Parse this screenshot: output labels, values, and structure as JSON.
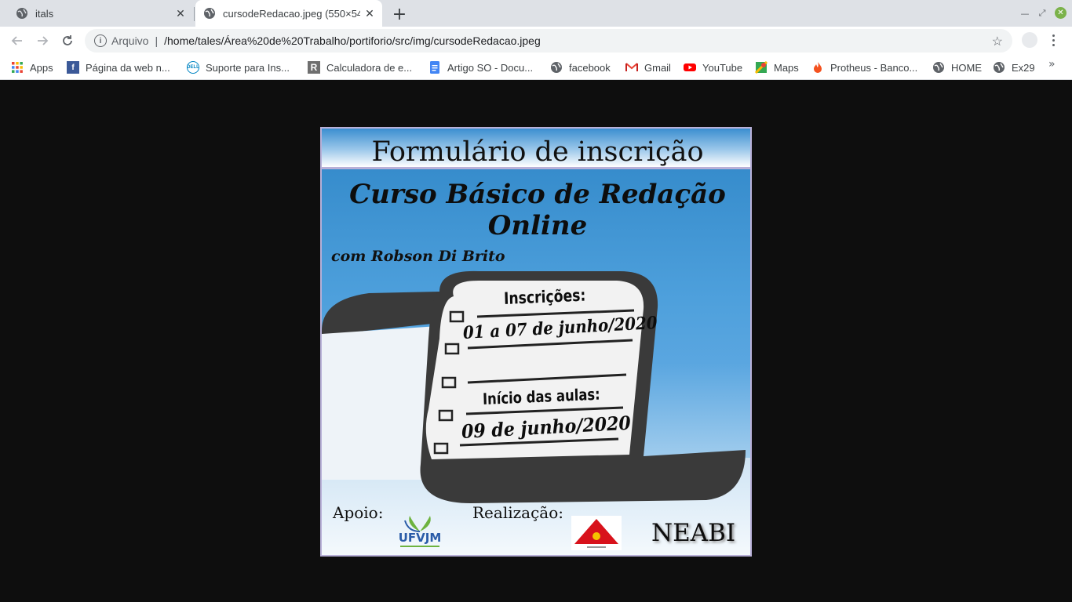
{
  "browser": {
    "tabs": [
      {
        "title": "itals",
        "active": false
      },
      {
        "title": "cursodeRedacao.jpeg (550×548)",
        "active": true
      }
    ],
    "address": {
      "scheme_label": "Arquivo",
      "divider": "|",
      "url": "/home/tales/Área%20de%20Trabalho/portiforio/src/img/cursodeRedacao.jpeg"
    },
    "bookmarks": [
      {
        "label": "Apps",
        "icon": "apps-grid-icon"
      },
      {
        "label": "Página da web n...",
        "icon": "facebook-icon"
      },
      {
        "label": "Suporte para Ins...",
        "icon": "dell-icon"
      },
      {
        "label": "Calculadora de e...",
        "icon": "r-icon"
      },
      {
        "label": "Artigo SO - Docu...",
        "icon": "docs-icon"
      },
      {
        "label": "facebook",
        "icon": "globe-icon"
      },
      {
        "label": "Gmail",
        "icon": "gmail-icon"
      },
      {
        "label": "YouTube",
        "icon": "youtube-icon"
      },
      {
        "label": "Maps",
        "icon": "maps-icon"
      },
      {
        "label": "Protheus - Banco...",
        "icon": "fire-icon"
      },
      {
        "label": "HOME",
        "icon": "globe-icon"
      },
      {
        "label": "Ex29",
        "icon": "globe-icon"
      }
    ],
    "overflow": "»",
    "colors": {
      "tabstrip": "#dee1e6",
      "omnibox": "#f1f3f4"
    }
  },
  "poster": {
    "header": "Formulário de inscrição",
    "course_line1": "Curso Básico de Redação",
    "course_line2": "Online",
    "teacher": "com Robson Di Brito",
    "inscricoes_label": "Inscrições:",
    "inscricoes_dates": "01 a 07 de junho/2020",
    "inicio_label": "Início das aulas:",
    "inicio_date": "09 de junho/2020",
    "apoio": "Apoio:",
    "realizacao": "Realização:",
    "ufvjm": "UFVJM",
    "neabi": "NEABI",
    "colors": {
      "sky": "#4ea0dc",
      "scroll_dark": "#3a3a3a",
      "paper": "#f2f2f2"
    }
  }
}
